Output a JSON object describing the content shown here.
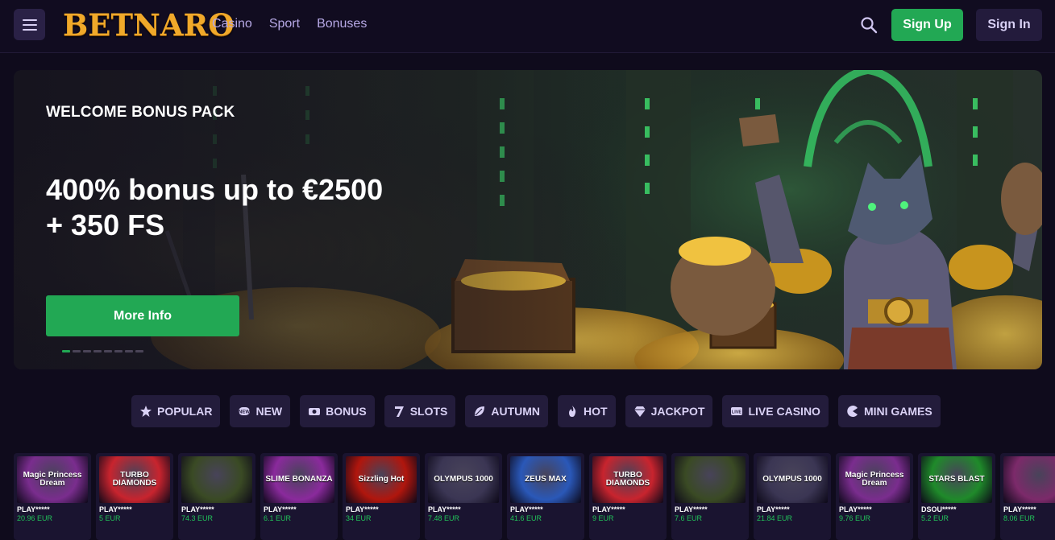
{
  "header": {
    "logo": "BETNARO",
    "nav": [
      "Casino",
      "Sport",
      "Bonuses"
    ],
    "signup_label": "Sign Up",
    "signin_label": "Sign In"
  },
  "banner": {
    "kicker": "WELCOME BONUS PACK",
    "title_line1": "400% bonus up to €2500",
    "title_line2": "+ 350 FS",
    "cta_label": "More Info",
    "slide_count": 8,
    "active_slide": 1
  },
  "categories": [
    {
      "label": "POPULAR",
      "icon": "star-icon"
    },
    {
      "label": "NEW",
      "icon": "new-badge-icon"
    },
    {
      "label": "BONUS",
      "icon": "bonus-icon"
    },
    {
      "label": "SLOTS",
      "icon": "seven-icon"
    },
    {
      "label": "AUTUMN",
      "icon": "leaf-icon"
    },
    {
      "label": "HOT",
      "icon": "flame-icon"
    },
    {
      "label": "JACKPOT",
      "icon": "diamond-icon"
    },
    {
      "label": "LIVE CASINO",
      "icon": "live-icon"
    },
    {
      "label": "MINI GAMES",
      "icon": "pacman-icon"
    }
  ],
  "games": [
    {
      "title": "Magic Princess Dream",
      "label": "PLAY*****",
      "amount": "20.96 EUR",
      "bg": "#7a2d8e"
    },
    {
      "title": "TURBO DIAMONDS",
      "label": "PLAY*****",
      "amount": "5 EUR",
      "bg": "#c8242e"
    },
    {
      "title": "",
      "label": "PLAY*****",
      "amount": "74.3 EUR",
      "bg": "#3a4a24"
    },
    {
      "title": "SLIME BONANZA",
      "label": "PLAY*****",
      "amount": "6.1 EUR",
      "bg": "#8a2a9c"
    },
    {
      "title": "Sizzling Hot",
      "label": "PLAY*****",
      "amount": "34 EUR",
      "bg": "#b0160d"
    },
    {
      "title": "OLYMPUS 1000",
      "label": "PLAY*****",
      "amount": "7.48 EUR",
      "bg": "#3b3654"
    },
    {
      "title": "ZEUS MAX",
      "label": "PLAY*****",
      "amount": "41.6 EUR",
      "bg": "#2a58b8"
    },
    {
      "title": "TURBO DIAMONDS",
      "label": "PLAY*****",
      "amount": "9 EUR",
      "bg": "#c8242e"
    },
    {
      "title": "",
      "label": "PLAY*****",
      "amount": "7.6 EUR",
      "bg": "#3a4a24"
    },
    {
      "title": "OLYMPUS 1000",
      "label": "PLAY*****",
      "amount": "21.84 EUR",
      "bg": "#3b3654"
    },
    {
      "title": "Magic Princess Dream",
      "label": "PLAY*****",
      "amount": "9.76 EUR",
      "bg": "#7a2d8e"
    },
    {
      "title": "STARS BLAST",
      "label": "DSOU*****",
      "amount": "5.2 EUR",
      "bg": "#1f8a2a"
    },
    {
      "title": "",
      "label": "PLAY*****",
      "amount": "8.06 EUR",
      "bg": "#7c2a6a"
    }
  ],
  "colors": {
    "background": "#0f0b1c",
    "accent_green": "#22a854",
    "nav_text": "#b7a9e6",
    "chip_bg": "#231c3b"
  }
}
